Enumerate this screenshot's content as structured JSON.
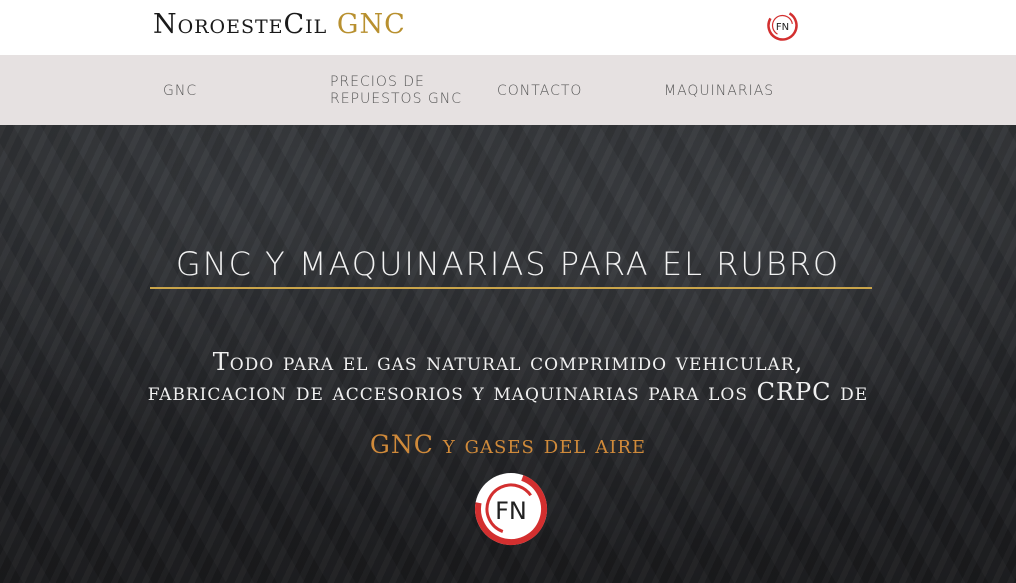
{
  "header": {
    "brand_main": "NoroesteCil",
    "brand_accent": "GNC",
    "logo_text": "FN"
  },
  "nav": {
    "items": [
      {
        "label": "GNC"
      },
      {
        "label": "PRECIOS DE"
      },
      {
        "label": "REPUESTOS GNC"
      },
      {
        "label": "CONTACTO"
      },
      {
        "label": "MAQUINARIAS"
      }
    ]
  },
  "hero": {
    "title": "GNC Y MAQUINARIAS PARA EL RUBRO",
    "subtitle_line1": "Todo para el gas natural comprimido vehicular,",
    "subtitle_line2": "fabricacion de accesorios y maquinarias para los CRPC de",
    "accent_text": "GNC y gases del aire",
    "logo_text": "FN"
  },
  "colors": {
    "accent_gold": "#b8902f",
    "accent_orange": "#d08a3a",
    "nav_bg": "#e6e1e1",
    "logo_red": "#d32f2f"
  }
}
